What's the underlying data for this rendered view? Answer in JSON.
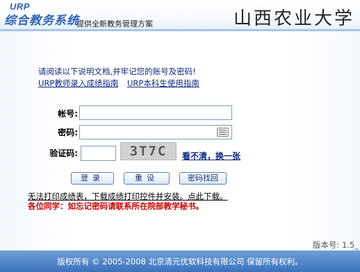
{
  "header": {
    "logo_line1": "URP",
    "logo_line2": "综合教务系统",
    "slogan": "提供全新教务管理方案",
    "university_name": "山西农业大学"
  },
  "main": {
    "notice": "请阅读以下说明文档,并牢记您的账号及密码!",
    "guide_teacher": "URP教师录入成绩指南",
    "guide_student": "URP本科生使用指南",
    "account_label": "帐号:",
    "account_value": "",
    "password_label": "密码:",
    "password_value": "",
    "captcha_label": "验证码:",
    "captcha_value": "",
    "captcha_text": "3T7C",
    "refresh_captcha": "看不清，换一张",
    "login_button": "登录",
    "reset_button": "重设",
    "retrieve_button": "密码找回",
    "print_notice": "无法打印成绩表，下载成绩打印控件并安装。点此下载。",
    "forgot_notice": "各位同学：如忘记密码请联系所在院部教学秘书。",
    "version": "版本号: 1.5_"
  },
  "footer": {
    "copyright": "版权所有 © 2005-2008 北京清元优软科技有限公司 保留所有权利。"
  },
  "colors": {
    "brand_blue": "#2f63b6",
    "link_blue": "#0d2a80",
    "warning_red": "#d10000",
    "footer_blue": "#4a7fc4"
  },
  "icons": {
    "keyboard": "keyboard-icon"
  }
}
